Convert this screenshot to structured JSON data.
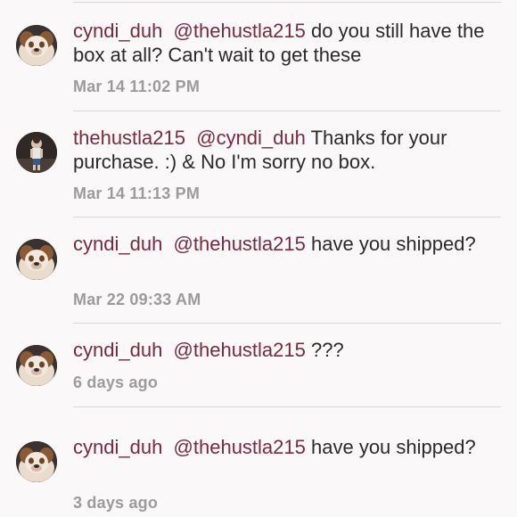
{
  "comments": [
    {
      "username": "cyndi_duh",
      "mention": "@thehustla215",
      "message": "do you still have the box at all? Can't wait to get these",
      "timestamp": "Mar 14 11:02 PM",
      "avatar": "bulldog-avatar"
    },
    {
      "username": "thehustla215",
      "mention": "@cyndi_duh",
      "message": "Thanks for your purchase. :)  & No I'm sorry no box.",
      "timestamp": "Mar 14 11:13 PM",
      "avatar": "person-avatar"
    },
    {
      "username": "cyndi_duh",
      "mention": "@thehustla215",
      "message": "have you shipped?",
      "timestamp": "Mar 22 09:33 AM",
      "avatar": "bulldog-avatar"
    },
    {
      "username": "cyndi_duh",
      "mention": "@thehustla215",
      "message": "???",
      "timestamp": "6 days ago",
      "avatar": "bulldog-avatar"
    },
    {
      "username": "cyndi_duh",
      "mention": "@thehustla215",
      "message": "have you shipped?",
      "timestamp": "3 days ago",
      "avatar": "bulldog-avatar"
    }
  ],
  "colors": {
    "username": "#7a2a3e",
    "text": "#2a2a2a",
    "timestamp": "#9b9b9b",
    "background": "#fbf8f9",
    "divider": "#d9d6d7"
  }
}
